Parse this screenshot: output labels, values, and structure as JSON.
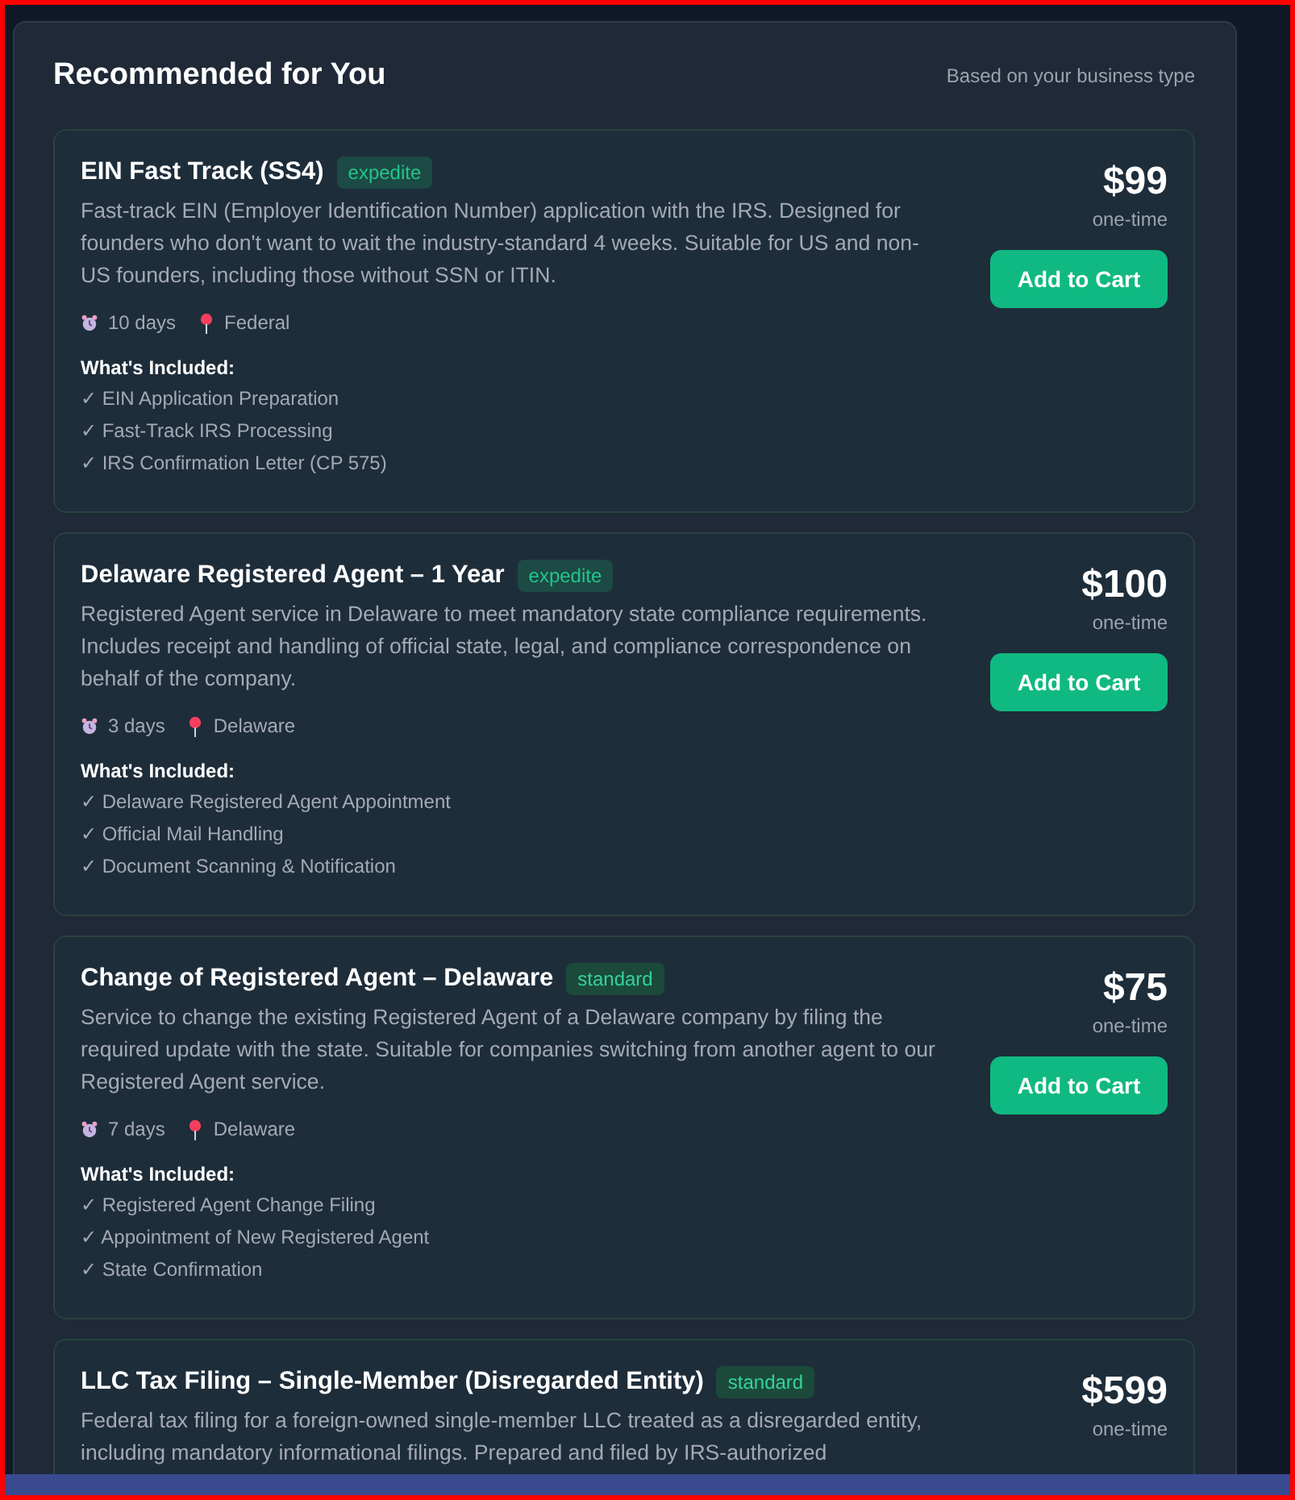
{
  "section": {
    "title": "Recommended for You",
    "subtitle": "Based on your business type"
  },
  "services": [
    {
      "title": "EIN Fast Track (SS4)",
      "tag": "expedite",
      "description": "Fast-track EIN (Employer Identification Number) application with the IRS. Designed for founders who don't want to wait the industry-standard 4 weeks. Suitable for US and non-US founders, including those without SSN or ITIN.",
      "duration": "10 days",
      "location": "Federal",
      "price": "$99",
      "billing": "one-time",
      "button": "Add to Cart",
      "included_heading": "What's Included:",
      "included": [
        "✓ EIN Application Preparation",
        "✓ Fast-Track IRS Processing",
        "✓ IRS Confirmation Letter (CP 575)"
      ]
    },
    {
      "title": "Delaware Registered Agent – 1 Year",
      "tag": "expedite",
      "description": "Registered Agent service in Delaware to meet mandatory state compliance requirements. Includes receipt and handling of official state, legal, and compliance correspondence on behalf of the company.",
      "duration": "3 days",
      "location": "Delaware",
      "price": "$100",
      "billing": "one-time",
      "button": "Add to Cart",
      "included_heading": "What's Included:",
      "included": [
        "✓ Delaware Registered Agent Appointment",
        "✓ Official Mail Handling",
        "✓ Document Scanning & Notification"
      ]
    },
    {
      "title": "Change of Registered Agent – Delaware",
      "tag": "standard",
      "description": "Service to change the existing Registered Agent of a Delaware company by filing the required update with the state. Suitable for companies switching from another agent to our Registered Agent service.",
      "duration": "7 days",
      "location": "Delaware",
      "price": "$75",
      "billing": "one-time",
      "button": "Add to Cart",
      "included_heading": "What's Included:",
      "included": [
        "✓ Registered Agent Change Filing",
        "✓ Appointment of New Registered Agent",
        "✓ State Confirmation"
      ]
    },
    {
      "title": "LLC Tax Filing – Single-Member (Disregarded Entity)",
      "tag": "standard",
      "description": "Federal tax filing for a foreign-owned single-member LLC treated as a disregarded entity, including mandatory informational filings. Prepared and filed by IRS-authorized",
      "price": "$599",
      "billing": "one-time"
    }
  ]
}
